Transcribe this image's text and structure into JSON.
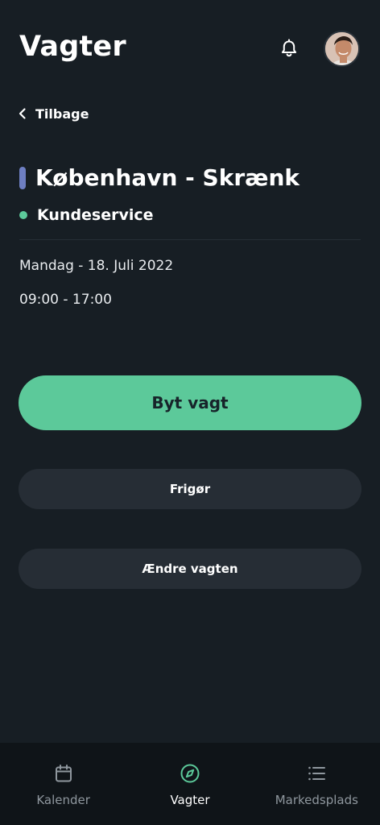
{
  "header": {
    "title": "Vagter",
    "notification_icon": "bell-icon",
    "avatar_icon": "user-avatar"
  },
  "back": {
    "label": "Tilbage",
    "icon": "chevron-left-icon"
  },
  "shift": {
    "location": "København - Skrænk",
    "location_color": "#6e7fc2",
    "department": "Kundeservice",
    "department_color": "#5cc99a",
    "date": "Mandag - 18. Juli 2022",
    "time": "09:00 - 17:00"
  },
  "actions": {
    "swap_label": "Byt vagt",
    "release_label": "Frigør",
    "change_label": "Ændre vagten"
  },
  "colors": {
    "background": "#171e24",
    "accent": "#5cc99a",
    "secondary_button": "#262d35",
    "nav_background": "#0f1418"
  },
  "nav": {
    "items": [
      {
        "label": "Kalender",
        "icon": "calendar-icon",
        "active": false
      },
      {
        "label": "Vagter",
        "icon": "compass-icon",
        "active": true
      },
      {
        "label": "Markedsplads",
        "icon": "list-icon",
        "active": false
      }
    ]
  }
}
